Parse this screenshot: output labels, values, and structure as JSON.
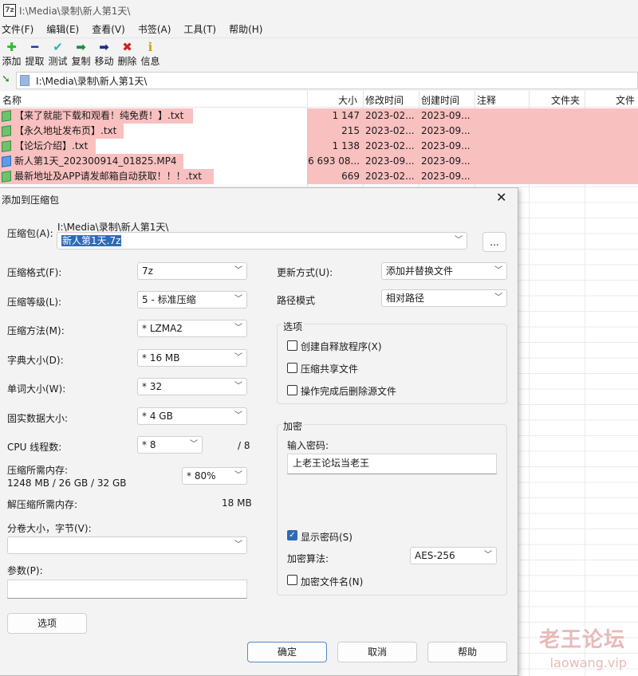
{
  "window": {
    "title": "I:\\Media\\录制\\新人第1天\\",
    "icon_text": "7z"
  },
  "menu": [
    "文件(F)",
    "编辑(E)",
    "查看(V)",
    "书签(A)",
    "工具(T)",
    "帮助(H)"
  ],
  "toolbar": [
    {
      "label": "添加",
      "icon": "plus-icon",
      "color": "#2bbd2b",
      "glyph": "✚"
    },
    {
      "label": "提取",
      "icon": "minus-icon",
      "color": "#1f3fa8",
      "glyph": "━"
    },
    {
      "label": "测试",
      "icon": "check-icon",
      "color": "#2ab3c8",
      "glyph": "✔"
    },
    {
      "label": "复制",
      "icon": "copy-arrow-icon",
      "color": "#1f8a4a",
      "glyph": "➡"
    },
    {
      "label": "移动",
      "icon": "move-arrow-icon",
      "color": "#1f2f88",
      "glyph": "➡"
    },
    {
      "label": "删除",
      "icon": "delete-icon",
      "color": "#d21f1f",
      "glyph": "✖"
    },
    {
      "label": "信息",
      "icon": "info-icon",
      "color": "#c9a400",
      "glyph": "ℹ"
    }
  ],
  "address": "I:\\Media\\录制\\新人第1天\\",
  "columns": [
    "名称",
    "大小",
    "修改时间",
    "创建时间",
    "注释",
    "文件夹",
    "文件"
  ],
  "files": [
    {
      "name": "【来了就能下载和观看！纯免费！】.txt",
      "size": "1 147",
      "modified": "2023-02...",
      "created": "2023-09...",
      "type": "text"
    },
    {
      "name": "【永久地址发布页】.txt",
      "size": "215",
      "modified": "2023-02...",
      "created": "2023-09...",
      "type": "text"
    },
    {
      "name": "【论坛介绍】.txt",
      "size": "1 138",
      "modified": "2023-02...",
      "created": "2023-09...",
      "type": "text"
    },
    {
      "name": "新人第1天_202300914_01825.MP4",
      "size": "6 693 08...",
      "modified": "2023-09...",
      "created": "2023-09...",
      "type": "video"
    },
    {
      "name": "最新地址及APP请发邮箱自动获取！！！.txt",
      "size": "669",
      "modified": "2023-02...",
      "created": "2023-09...",
      "type": "text"
    }
  ],
  "dialog": {
    "title": "添加到压缩包",
    "archive_label": "压缩包(A):",
    "archive_path": "I:\\Media\\录制\\新人第1天\\",
    "archive_name": "新人第1天.7z",
    "browse": "...",
    "format_label": "压缩格式(F):",
    "format": "7z",
    "level_label": "压缩等级(L):",
    "level": "5 - 标准压缩",
    "method_label": "压缩方法(M):",
    "method": "* LZMA2",
    "dict_label": "字典大小(D):",
    "dict": "* 16 MB",
    "word_label": "单词大小(W):",
    "word": "* 32",
    "solid_label": "固实数据大小:",
    "solid": "* 4 GB",
    "cpu_label": "CPU 线程数:",
    "cpu": "* 8",
    "cpu_max": "/ 8",
    "mem_label": "压缩所需内存:",
    "mem_value": "1248 MB / 26 GB / 32 GB",
    "mem_pct": "* 80%",
    "decomp_label": "解压缩所需内存:",
    "decomp_value": "18 MB",
    "split_label": "分卷大小，字节(V):",
    "params_label": "参数(P):",
    "options_button": "选项",
    "update_label": "更新方式(U):",
    "update": "添加并替换文件",
    "path_label": "路径模式",
    "path_mode": "相对路径",
    "options_group": "选项",
    "opt_sfx": "创建自释放程序(X)",
    "opt_shared": "压缩共享文件",
    "opt_delete": "操作完成后删除源文件",
    "enc_group": "加密",
    "pwd_label": "输入密码:",
    "pwd_value": "上老王论坛当老王",
    "show_pwd": "显示密码(S)",
    "enc_method_label": "加密算法:",
    "enc_method": "AES-256",
    "enc_names": "加密文件名(N)",
    "ok": "确定",
    "cancel": "取消",
    "help": "帮助",
    "close": "✕"
  },
  "watermark": {
    "line1": "老王论坛",
    "line2": "laowang.vip"
  }
}
